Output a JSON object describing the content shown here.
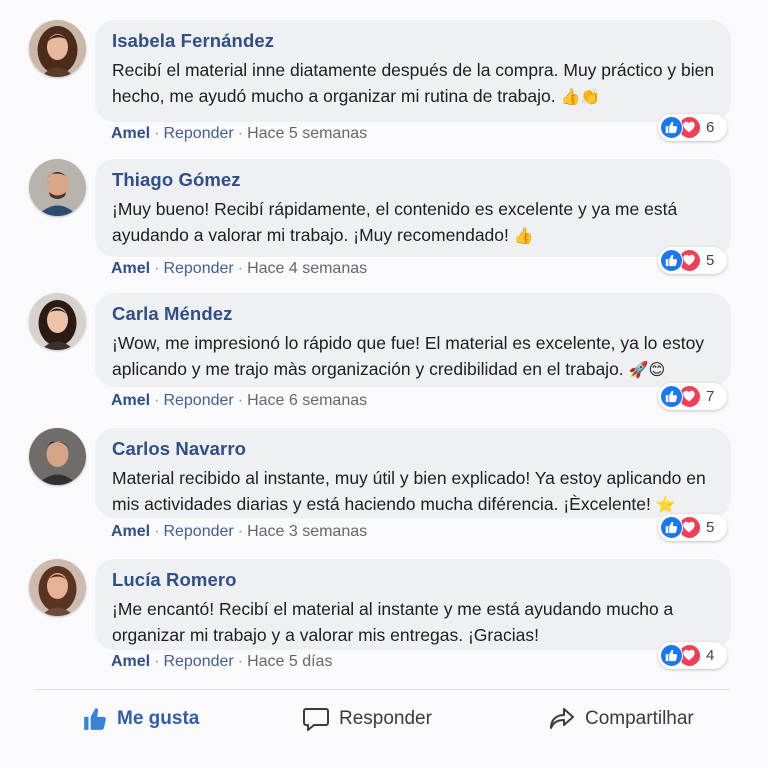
{
  "comments": [
    {
      "author": "Isabela Fernández",
      "text": "Recibí el material inne diatamente después de la compra. Muy práctico y bien hecho, me ayudó mucho a organizar mi rutina de trabajo.",
      "emoji": "👍👏",
      "like_label": "Amel",
      "reply_label": "Reponder",
      "time": "Hace 5 semanas",
      "reaction_count": "6"
    },
    {
      "author": "Thiago Gómez",
      "text": "¡Muy bueno! Recibí rápidamente, el contenido es excelente y ya me está ayudando a valorar mi trabajo. ¡Muy recomendado!",
      "emoji": "👍",
      "like_label": "Amel",
      "reply_label": "Reponder",
      "time": "Hace 4 semanas",
      "reaction_count": "5"
    },
    {
      "author": "Carla Méndez",
      "text": "¡Wow, me impresionó lo rápido que fue! El material es excelente, ya lo estoy aplicando y me trajo màs organización y credibilidad en el trabajo.",
      "emoji": "🚀😊",
      "like_label": "Amel",
      "reply_label": "Reponder",
      "time": "Hace 6 semanas",
      "reaction_count": "7"
    },
    {
      "author": "Carlos Navarro",
      "text": "Material recibido al instante, muy útil y bien explicado! Ya estoy aplicando en mis actividades diarias y está haciendo mucha diférencia. ¡Èxcelente!",
      "emoji": "⭐",
      "like_label": "Amel",
      "reply_label": "Reponder",
      "time": "Hace 3 semanas",
      "reaction_count": "5"
    },
    {
      "author": "Lucía Romero",
      "text": "¡Me encantó! Recibí el material al instante y me está ayudando mucho a organizar mi trabajo y a valorar mis entregas. ¡Gracias!",
      "emoji": "",
      "like_label": "Amel",
      "reply_label": "Reponder",
      "time": "Hace 5 días",
      "reaction_count": "4"
    }
  ],
  "actions": {
    "like": "Me gusta",
    "reply": "Responder",
    "share": "Compartilhar"
  },
  "icons": {
    "reaction_like": "thumbs-up-icon",
    "reaction_love": "heart-icon",
    "action_like": "thumbs-up-icon",
    "action_reply": "speech-bubble-icon",
    "action_share": "share-arrow-icon"
  },
  "colors": {
    "author": "#2f4f86",
    "bubble": "#eef0f4",
    "like_blue": "#1877f2",
    "love_red": "#f33e58",
    "action_like": "#2f5fa8"
  }
}
